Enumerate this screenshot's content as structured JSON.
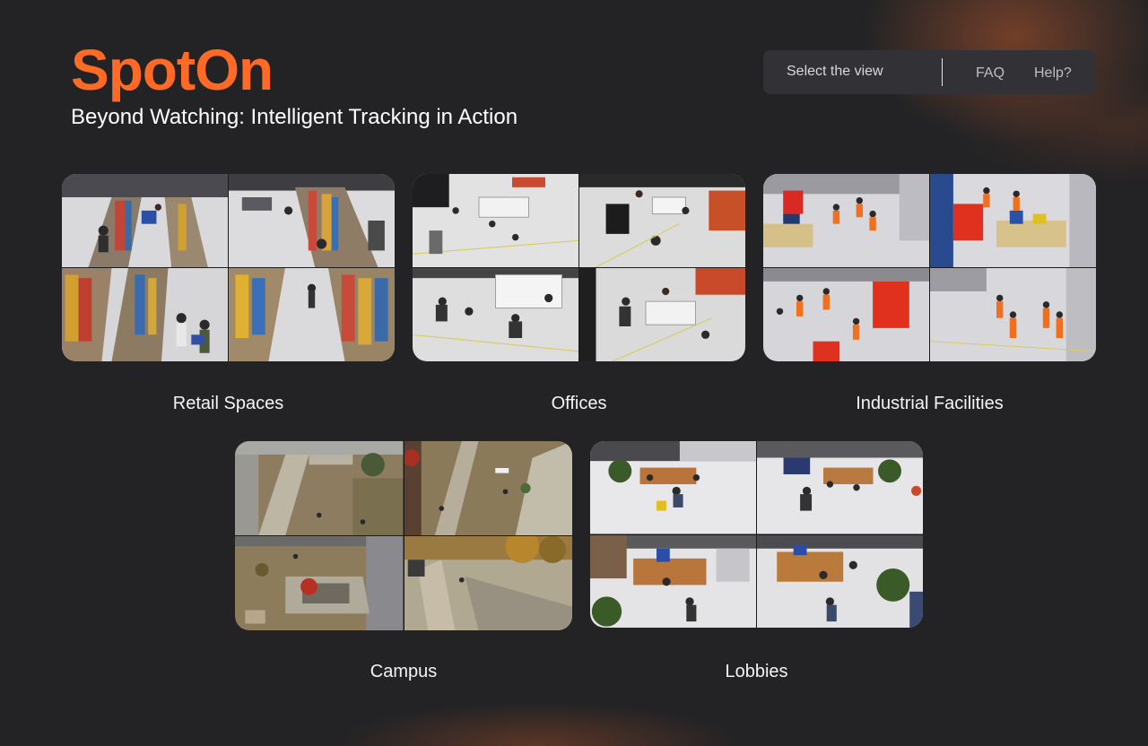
{
  "header": {
    "brand": "SpotOn",
    "tagline": "Beyond Watching: Intelligent Tracking in Action"
  },
  "nav": {
    "select_label": "Select the view",
    "faq_label": "FAQ",
    "help_label": "Help?"
  },
  "views": [
    {
      "label": "Retail Spaces"
    },
    {
      "label": "Offices"
    },
    {
      "label": "Industrial Facilities"
    },
    {
      "label": "Campus"
    },
    {
      "label": "Lobbies"
    }
  ],
  "colors": {
    "accent": "#ff6a26",
    "background": "#232325",
    "nav_bg": "#323236"
  }
}
